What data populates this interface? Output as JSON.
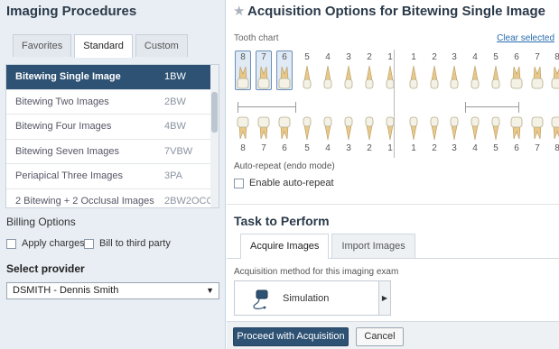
{
  "left": {
    "title": "Imaging Procedures",
    "tabs": [
      {
        "label": "Favorites",
        "active": false
      },
      {
        "label": "Standard",
        "active": true
      },
      {
        "label": "Custom",
        "active": false
      }
    ],
    "procedures": [
      {
        "name": "Bitewing Single Image",
        "code": "1BW",
        "selected": true
      },
      {
        "name": "Bitewing Two Images",
        "code": "2BW",
        "selected": false
      },
      {
        "name": "Bitewing Four Images",
        "code": "4BW",
        "selected": false
      },
      {
        "name": "Bitewing Seven Images",
        "code": "7VBW",
        "selected": false
      },
      {
        "name": "Periapical Three Images",
        "code": "3PA",
        "selected": false
      },
      {
        "name": "2 Bitewing + 2 Occlusal Images",
        "code": "2BW2OCC",
        "selected": false
      }
    ],
    "billing": {
      "title": "Billing Options",
      "apply_charges": "Apply charges",
      "bill_third_party": "Bill to third party"
    },
    "provider": {
      "title": "Select provider",
      "selected": "DSMITH - Dennis Smith"
    }
  },
  "right": {
    "title": "Acquisition Options for Bitewing Single Image",
    "tooth_chart": {
      "label": "Tooth chart",
      "clear_link": "Clear selected",
      "upper_numbers": [
        "8",
        "7",
        "6",
        "5",
        "4",
        "3",
        "2",
        "1",
        "1",
        "2",
        "3",
        "4",
        "5",
        "6",
        "7",
        "8"
      ],
      "lower_numbers": [
        "8",
        "7",
        "6",
        "5",
        "4",
        "3",
        "2",
        "1",
        "1",
        "2",
        "3",
        "4",
        "5",
        "6",
        "7",
        "8"
      ],
      "selected_upper": [
        0,
        1,
        2
      ]
    },
    "auto_repeat": {
      "title": "Auto-repeat (endo mode)",
      "enable_label": "Enable auto-repeat"
    },
    "task": {
      "title": "Task to Perform",
      "tabs": [
        {
          "label": "Acquire Images",
          "active": true
        },
        {
          "label": "Import Images",
          "active": false
        }
      ],
      "method_label": "Acquisition method for this imaging exam",
      "method": "Simulation"
    },
    "buttons": {
      "proceed": "Proceed with Acquisition",
      "cancel": "Cancel"
    }
  },
  "colors": {
    "selected_row": "#2e5274",
    "primary_button": "#2e5274",
    "link": "#2a6cb0",
    "left_bg": "#e8eef4"
  }
}
